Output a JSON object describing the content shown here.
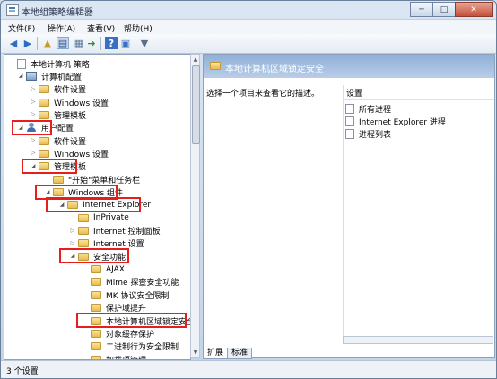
{
  "window": {
    "title": "本地组策略编辑器",
    "min": "─",
    "max": "□",
    "close": "✕"
  },
  "menu": [
    "文件(F)",
    "操作(A)",
    "查看(V)",
    "帮助(H)"
  ],
  "tree": [
    {
      "label": "本地计算机 策略",
      "exp": "",
      "icon": "policy",
      "indent": 0
    },
    {
      "label": "计算机配置",
      "exp": "◢",
      "icon": "computer",
      "indent": 1
    },
    {
      "label": "软件设置",
      "exp": "▷",
      "icon": "folder",
      "indent": 2
    },
    {
      "label": "Windows 设置",
      "exp": "▷",
      "icon": "folder",
      "indent": 2
    },
    {
      "label": "管理模板",
      "exp": "▷",
      "icon": "folder",
      "indent": 2
    },
    {
      "label": "用户配置",
      "exp": "◢",
      "icon": "user",
      "indent": 1
    },
    {
      "label": "软件设置",
      "exp": "▷",
      "icon": "folder",
      "indent": 2
    },
    {
      "label": "Windows 设置",
      "exp": "▷",
      "icon": "folder",
      "indent": 2
    },
    {
      "label": "管理模板",
      "exp": "◢",
      "icon": "folder",
      "indent": 2
    },
    {
      "label": "\"开始\"菜单和任务栏",
      "exp": "",
      "icon": "folder",
      "indent": 3
    },
    {
      "label": "Windows 组件",
      "exp": "◢",
      "icon": "folder",
      "indent": 3
    },
    {
      "label": "Internet Explorer",
      "exp": "◢",
      "icon": "folder",
      "indent": 4
    },
    {
      "label": "InPrivate",
      "exp": "",
      "icon": "folder",
      "indent": 5
    },
    {
      "label": "Internet 控制面板",
      "exp": "▷",
      "icon": "folder",
      "indent": 5
    },
    {
      "label": "Internet 设置",
      "exp": "▷",
      "icon": "folder",
      "indent": 5
    },
    {
      "label": "安全功能",
      "exp": "◢",
      "icon": "folder",
      "indent": 5
    },
    {
      "label": "AJAX",
      "exp": "",
      "icon": "folder",
      "indent": 6
    },
    {
      "label": "Mime 探查安全功能",
      "exp": "",
      "icon": "folder",
      "indent": 6
    },
    {
      "label": "MK 协议安全限制",
      "exp": "",
      "icon": "folder",
      "indent": 6
    },
    {
      "label": "保护域提升",
      "exp": "",
      "icon": "folder",
      "indent": 6
    },
    {
      "label": "本地计算机区域锁定安全",
      "exp": "",
      "icon": "folder",
      "indent": 6
    },
    {
      "label": "对象缓存保护",
      "exp": "",
      "icon": "folder",
      "indent": 6
    },
    {
      "label": "二进制行为安全限制",
      "exp": "",
      "icon": "folder",
      "indent": 6
    },
    {
      "label": "加载项管理",
      "exp": "",
      "icon": "folder",
      "indent": 6
    }
  ],
  "right": {
    "header": "本地计算机区域锁定安全",
    "description": "选择一个项目来查看它的描述。",
    "settings_header": "设置",
    "settings": [
      "所有进程",
      "Internet Explorer 进程",
      "进程列表"
    ]
  },
  "tabs": [
    "扩展",
    "标准"
  ],
  "status": "3 个设置",
  "colors": {
    "highlight_box": "#e81e1e",
    "header_bg": "#8fb0d8"
  }
}
